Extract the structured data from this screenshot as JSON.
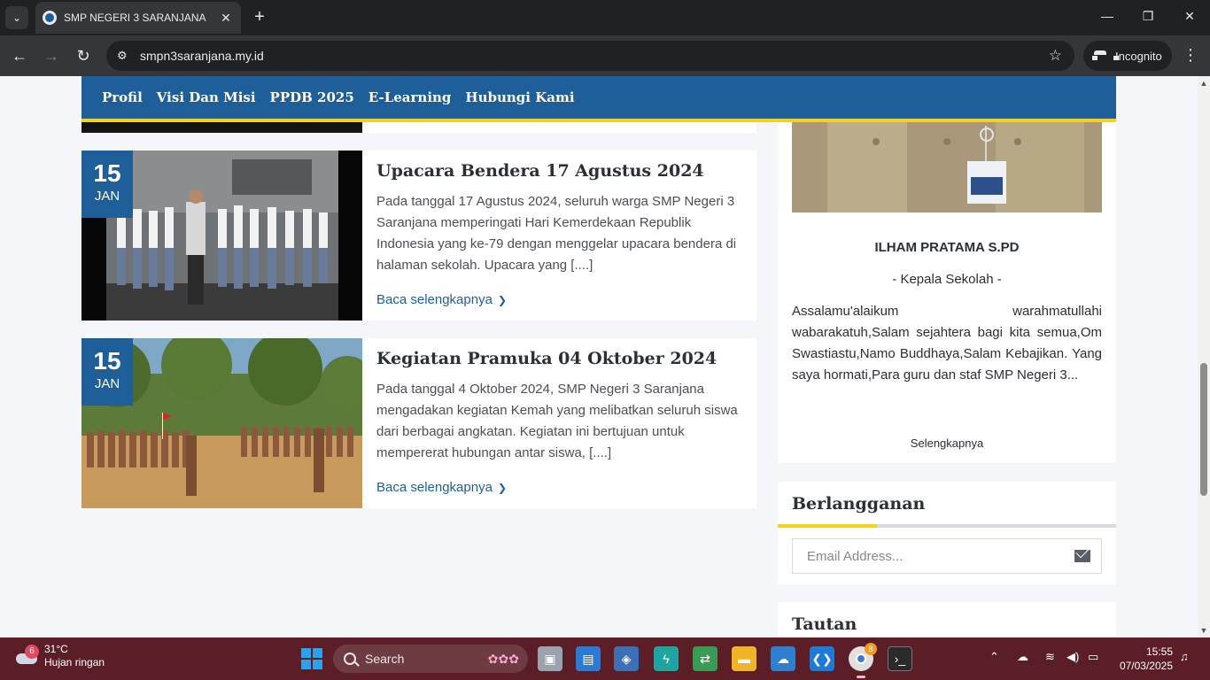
{
  "browser": {
    "tab_title": "SMP NEGERI 3 SARANJANA",
    "url": "smpn3saranjana.my.id",
    "incognito_label": "Incognito"
  },
  "nav": {
    "items": [
      "Profil",
      "Visi Dan Misi",
      "PPDB 2025",
      "E-Learning",
      "Hubungi Kami"
    ]
  },
  "posts": [
    {
      "day": "15",
      "month": "JAN",
      "title": "Upacara Bendera 17 Agustus 2024",
      "excerpt": "Pada tanggal 17 Agustus 2024, seluruh warga SMP Negeri 3 Saranjana memperingati Hari Kemerdekaan Republik Indonesia yang ke-79 dengan menggelar upacara bendera di halaman sekolah. Upacara yang [....]",
      "read_more": "Baca selengkapnya"
    },
    {
      "day": "15",
      "month": "JAN",
      "title": "Kegiatan Pramuka 04 Oktober 2024",
      "excerpt": "Pada tanggal 4 Oktober 2024, SMP Negeri 3 Saranjana mengadakan kegiatan Kemah yang melibatkan seluruh siswa dari berbagai angkatan. Kegiatan ini bertujuan untuk mempererat hubungan antar siswa, [....]",
      "read_more": "Baca selengkapnya"
    }
  ],
  "sidebar": {
    "principal_name": "ILHAM PRATAMA S.PD",
    "principal_role": "- Kepala Sekolah -",
    "greeting": "Assalamu'alaikum warahmatullahi wabarakatuh,Salam sejahtera bagi kita semua,Om Swastiastu,Namo Buddhaya,Salam Kebajikan. Yang saya hormati,Para guru dan staf SMP Negeri 3...",
    "more_label": "Selengkapnya",
    "subscribe_title": "Berlangganan",
    "email_placeholder": "Email Address...",
    "links_title": "Tautan"
  },
  "taskbar": {
    "weather_badge": "6",
    "temperature": "31°C",
    "weather_desc": "Hujan ringan",
    "search_label": "Search",
    "chrome_badge": "8",
    "time": "15:55",
    "date": "07/03/2025"
  },
  "colors": {
    "brand_blue": "#1f5f99",
    "accent_yellow": "#f4d21f",
    "taskbar": "#5b1e26"
  }
}
